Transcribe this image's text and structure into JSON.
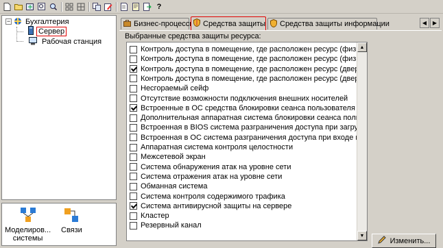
{
  "toolbar": {
    "icons": [
      "new-icon",
      "open-icon",
      "refresh-icon",
      "find-icon",
      "zoom-icon",
      "grid-icon",
      "grid2-icon",
      "copy-icon",
      "edit-icon",
      "page-icon",
      "report-icon",
      "export-icon",
      "help-icon"
    ]
  },
  "tree": {
    "root": "Бухгалтерия",
    "items": [
      "Сервер",
      "Рабочая станция"
    ],
    "toggle": "−"
  },
  "views": {
    "items": [
      "Моделиров...\nсистемы",
      "Связи"
    ]
  },
  "tabs": [
    {
      "label": "Бизнес-процессы"
    },
    {
      "label": "Средства защиты"
    },
    {
      "label": "Средства защиты информации"
    }
  ],
  "content": {
    "section_label": "Выбранные средства защиты ресурса:",
    "change_button": "Изменить...",
    "items": [
      {
        "label": "Контроль доступа в помещение, где расположен ресурс (физическая охра",
        "checked": false
      },
      {
        "label": "Контроль доступа в помещение, где расположен ресурс (физическая охра",
        "checked": false
      },
      {
        "label": "Контроль доступа в помещение, где расположен ресурс (дверь с замком,",
        "checked": true
      },
      {
        "label": "Контроль доступа в помещение, где расположен ресурс (дверь с замком)",
        "checked": false
      },
      {
        "label": "Несгораемый сейф",
        "checked": false
      },
      {
        "label": "Отсутствие возможности подключения внешних носителей",
        "checked": false
      },
      {
        "label": "Встроенные в ОС средства блокировки сеанса пользователя",
        "checked": true
      },
      {
        "label": "Дополнительная аппаратная система блокировки сеанса пользователя",
        "checked": false
      },
      {
        "label": "Встроенная в BIOS система разграничения доступа при загрузке",
        "checked": false
      },
      {
        "label": "Встроенная в ОС система разграничения доступа при входе в систему",
        "checked": false
      },
      {
        "label": "Аппаратная система контроля целостности",
        "checked": false
      },
      {
        "label": "Межсетевой экран",
        "checked": false
      },
      {
        "label": "Система обнаружения атак на уровне сети",
        "checked": false
      },
      {
        "label": "Система отражения атак на уровне сети",
        "checked": false
      },
      {
        "label": "Обманная система",
        "checked": false
      },
      {
        "label": "Система контроля содержимого трафика",
        "checked": false
      },
      {
        "label": "Система антивирусной защиты на сервере",
        "checked": true
      },
      {
        "label": "Кластер",
        "checked": false
      },
      {
        "label": "Резервный канал",
        "checked": false
      }
    ]
  }
}
